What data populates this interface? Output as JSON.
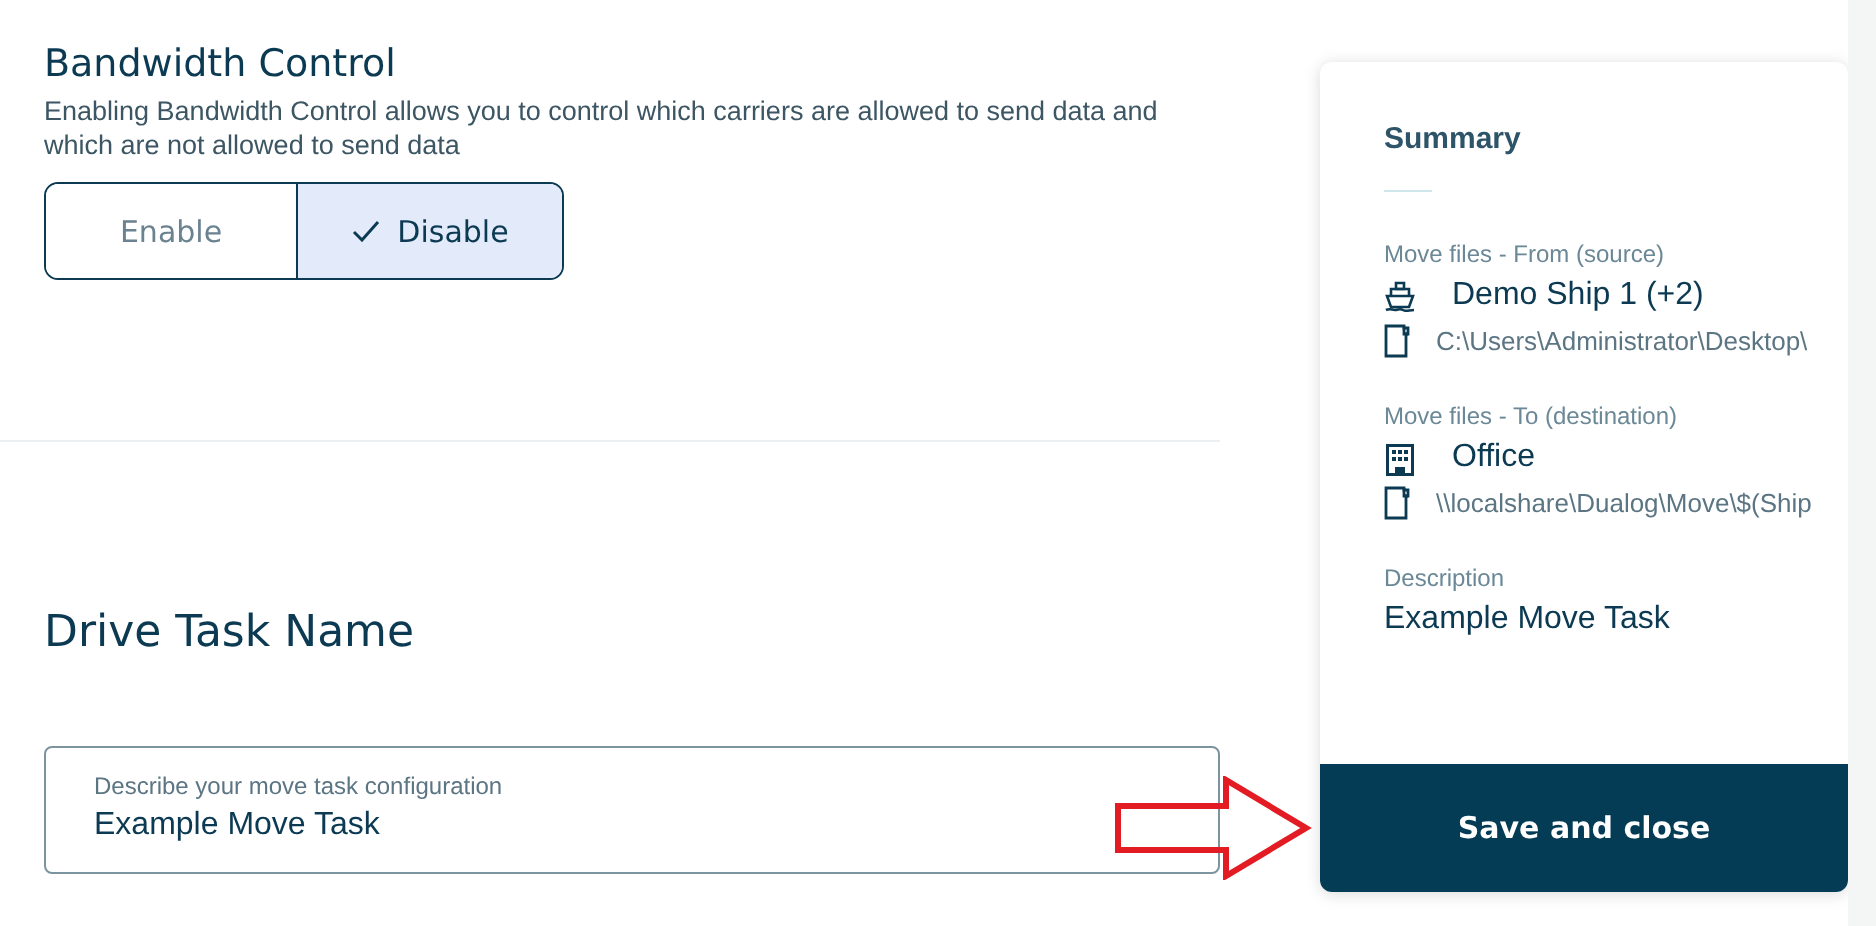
{
  "bandwidth": {
    "title": "Bandwidth Control",
    "description": "Enabling Bandwidth Control allows you to control which carriers are allowed to send data and which are not allowed to send data",
    "options": [
      {
        "label": "Enable",
        "selected": false
      },
      {
        "label": "Disable",
        "selected": true
      }
    ]
  },
  "task_name": {
    "title": "Drive Task Name",
    "field": {
      "label": "Describe your move task configuration",
      "value": "Example Move Task"
    }
  },
  "summary": {
    "title": "Summary",
    "sections": [
      {
        "label": "Move files - From (source)",
        "items": [
          {
            "kind": "ship",
            "text": "Demo Ship 1 (+2)"
          },
          {
            "kind": "path",
            "text": "C:\\Users\\Administrator\\Desktop\\"
          }
        ]
      },
      {
        "label": "Move files - To (destination)",
        "items": [
          {
            "kind": "office",
            "text": "Office"
          },
          {
            "kind": "path",
            "text": "\\\\localshare\\Dualog\\Move\\$(Ship"
          }
        ]
      },
      {
        "label": "Description",
        "items": [
          {
            "kind": "plain",
            "text": "Example Move Task"
          }
        ]
      }
    ],
    "button": "Save and close"
  }
}
